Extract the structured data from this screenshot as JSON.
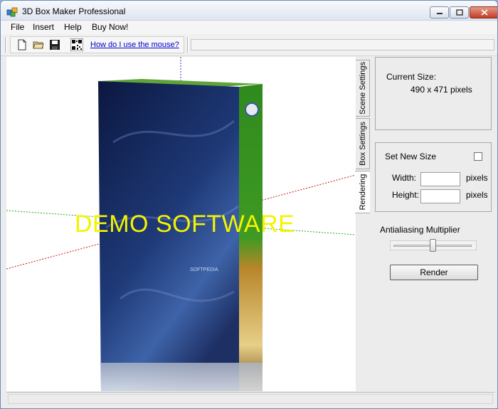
{
  "window": {
    "title": "3D Box Maker Professional"
  },
  "menu": [
    "File",
    "Insert",
    "Help",
    "Buy Now!"
  ],
  "toolbar": {
    "help_link": "How do I use the mouse?",
    "icons": [
      "new-document-icon",
      "open-folder-icon",
      "save-disk-icon",
      "qr-code-icon"
    ]
  },
  "viewport": {
    "watermark": "DEMO SOFTWARE"
  },
  "tabs": [
    {
      "label": "Scene Settings",
      "active": false
    },
    {
      "label": "Box Settings",
      "active": false
    },
    {
      "label": "Rendering",
      "active": true
    }
  ],
  "rendering": {
    "current_size_label": "Current Size:",
    "current_size_value": "490 x 471 pixels",
    "set_new_size_label": "Set New Size",
    "set_new_size_checked": false,
    "width_label": "Width:",
    "width_value": "",
    "height_label": "Height:",
    "height_value": "",
    "unit_label": "pixels",
    "antialiasing_label": "Antialiasing Multiplier",
    "antialiasing_level": 0.5,
    "render_button": "Render"
  },
  "colors": {
    "box_front_dark": "#0b1740",
    "box_front_light": "#3e63a8",
    "box_top": "#5fa33a",
    "box_side": "#2f8a1e",
    "watermark": "#f4f400"
  }
}
